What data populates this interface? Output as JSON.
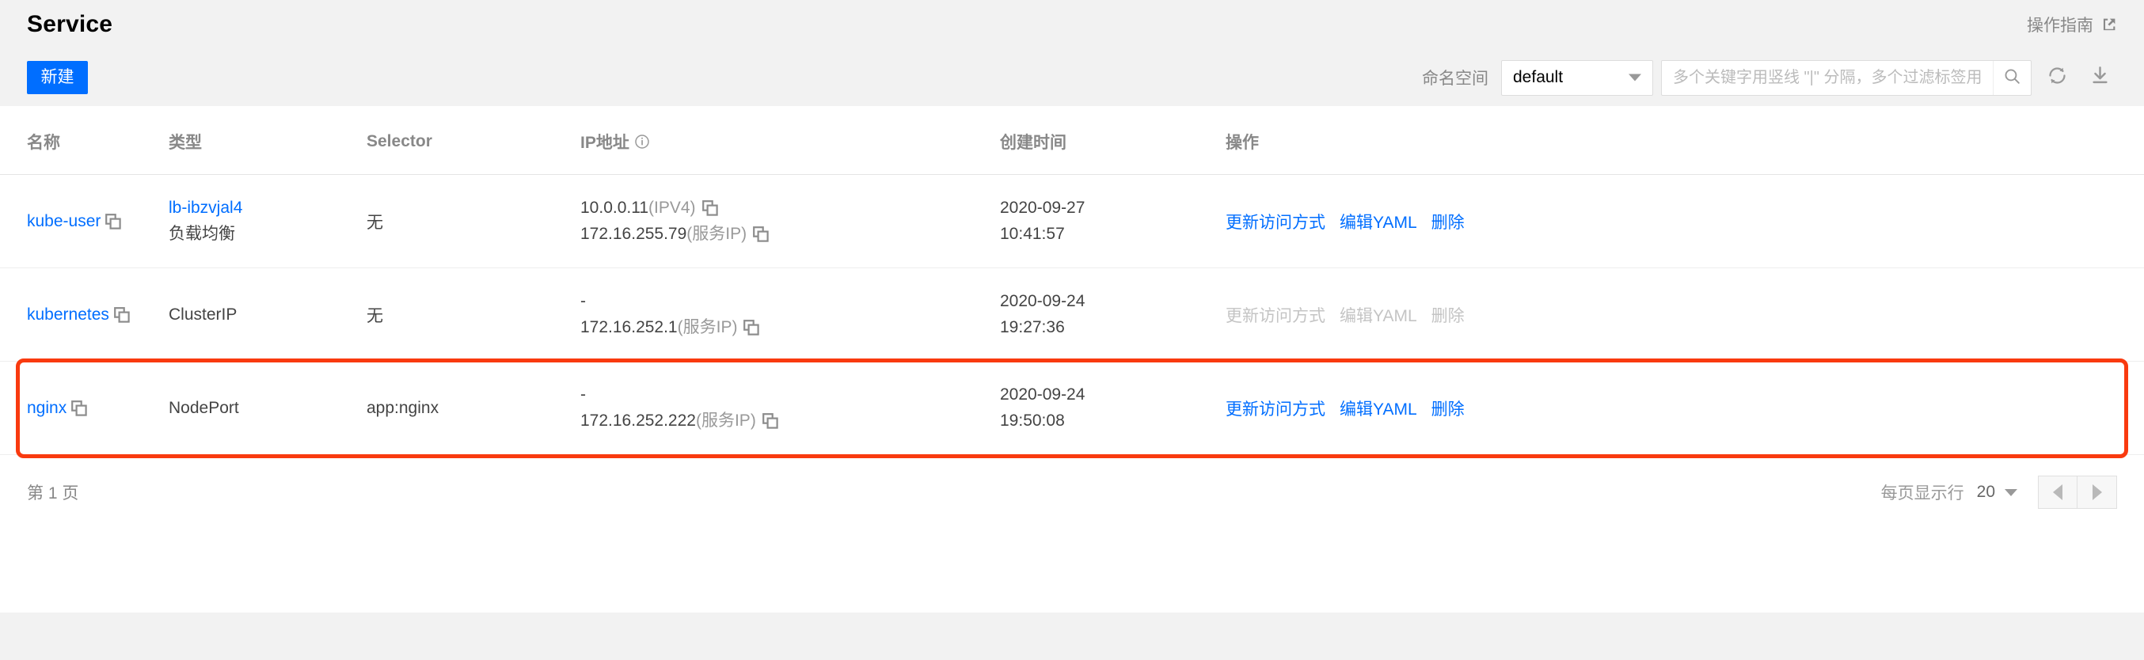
{
  "header": {
    "title": "Service",
    "guide_label": "操作指南",
    "guide_icon": "external-link-icon"
  },
  "toolbar": {
    "create_label": "新建",
    "namespace_label": "命名空间",
    "namespace_value": "default",
    "namespace_options": [
      "default"
    ],
    "search_placeholder": "多个关键字用竖线 \"|\" 分隔，多个过滤标签用回车键",
    "search_value": "",
    "search_icon": "search-icon",
    "refresh_icon": "refresh-icon",
    "download_icon": "download-icon"
  },
  "table": {
    "columns": [
      {
        "key": "name",
        "label": "名称"
      },
      {
        "key": "type",
        "label": "类型"
      },
      {
        "key": "selector",
        "label": "Selector"
      },
      {
        "key": "ip",
        "label": "IP地址",
        "info_icon": "info-icon"
      },
      {
        "key": "created",
        "label": "创建时间"
      },
      {
        "key": "actions",
        "label": "操作"
      }
    ],
    "rows": [
      {
        "name": "kube-user",
        "name_is_link": true,
        "type_link": "lb-ibzvjal4",
        "type_sub": "负载均衡",
        "selector": "无",
        "ip_lines": [
          {
            "value": "10.0.0.11",
            "suffix": "(IPV4)",
            "copy": true
          },
          {
            "value": "172.16.255.79",
            "suffix": "(服务IP)",
            "copy": true
          }
        ],
        "created_date": "2020-09-27",
        "created_time": "10:41:57",
        "actions": [
          {
            "label": "更新访问方式",
            "disabled": false
          },
          {
            "label": "编辑YAML",
            "disabled": false
          },
          {
            "label": "删除",
            "disabled": false
          }
        ],
        "highlighted": false
      },
      {
        "name": "kubernetes",
        "name_is_link": true,
        "type_text": "ClusterIP",
        "selector": "无",
        "ip_lines": [
          {
            "value": "-",
            "suffix": "",
            "copy": false
          },
          {
            "value": "172.16.252.1",
            "suffix": "(服务IP)",
            "copy": true
          }
        ],
        "created_date": "2020-09-24",
        "created_time": "19:27:36",
        "actions": [
          {
            "label": "更新访问方式",
            "disabled": true
          },
          {
            "label": "编辑YAML",
            "disabled": true
          },
          {
            "label": "删除",
            "disabled": true
          }
        ],
        "highlighted": false
      },
      {
        "name": "nginx",
        "name_is_link": true,
        "type_text": "NodePort",
        "selector": "app:nginx",
        "ip_lines": [
          {
            "value": "-",
            "suffix": "",
            "copy": false
          },
          {
            "value": "172.16.252.222",
            "suffix": "(服务IP)",
            "copy": true
          }
        ],
        "created_date": "2020-09-24",
        "created_time": "19:50:08",
        "actions": [
          {
            "label": "更新访问方式",
            "disabled": false
          },
          {
            "label": "编辑YAML",
            "disabled": false
          },
          {
            "label": "删除",
            "disabled": false
          }
        ],
        "highlighted": true,
        "highlight_color": "#f93a0f"
      }
    ]
  },
  "footer": {
    "page_indicator": "第 1 页",
    "rows_label": "每页显示行",
    "rows_value": "20",
    "prev_icon": "chevron-left-icon",
    "next_icon": "chevron-right-icon"
  }
}
